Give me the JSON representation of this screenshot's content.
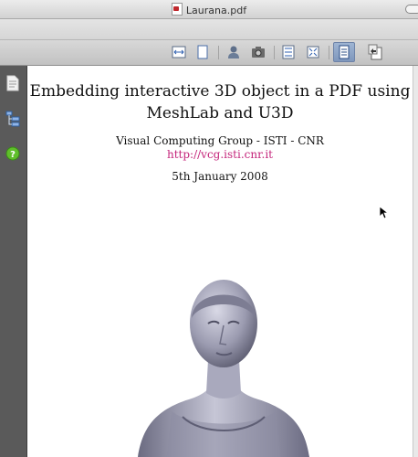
{
  "window": {
    "title": "Laurana.pdf",
    "file_icon": "pdf-file-icon"
  },
  "toolbar": {
    "buttons": [
      {
        "name": "fit-width-button",
        "icon": "fit-width-icon"
      },
      {
        "name": "single-page-button",
        "icon": "single-page-icon"
      },
      {
        "name": "3d-object-button",
        "icon": "3d-object-icon"
      },
      {
        "name": "snapshot-button",
        "icon": "camera-icon"
      },
      {
        "name": "fit-height-button",
        "icon": "fit-height-icon"
      },
      {
        "name": "fit-page-button",
        "icon": "fit-page-icon"
      },
      {
        "name": "content-view-button",
        "icon": "document-view-icon",
        "active": true
      },
      {
        "name": "back-button",
        "icon": "back-page-icon"
      }
    ]
  },
  "sidebar": {
    "items": [
      {
        "name": "sidebar-pages-button",
        "icon": "pages-icon"
      },
      {
        "name": "sidebar-outline-button",
        "icon": "outline-tree-icon"
      },
      {
        "name": "sidebar-help-button",
        "icon": "help-icon"
      }
    ]
  },
  "document": {
    "title_line1": "Embedding interactive 3D object in a PDF using",
    "title_line2": "MeshLab and U3D",
    "affiliation": "Visual Computing Group - ISTI - CNR",
    "url": "http://vcg.isti.cnr.it",
    "date": "5th January 2008",
    "figure": "3d-bust-model"
  },
  "colors": {
    "link": "#c4247a",
    "active_button": "#8aa3c8"
  }
}
